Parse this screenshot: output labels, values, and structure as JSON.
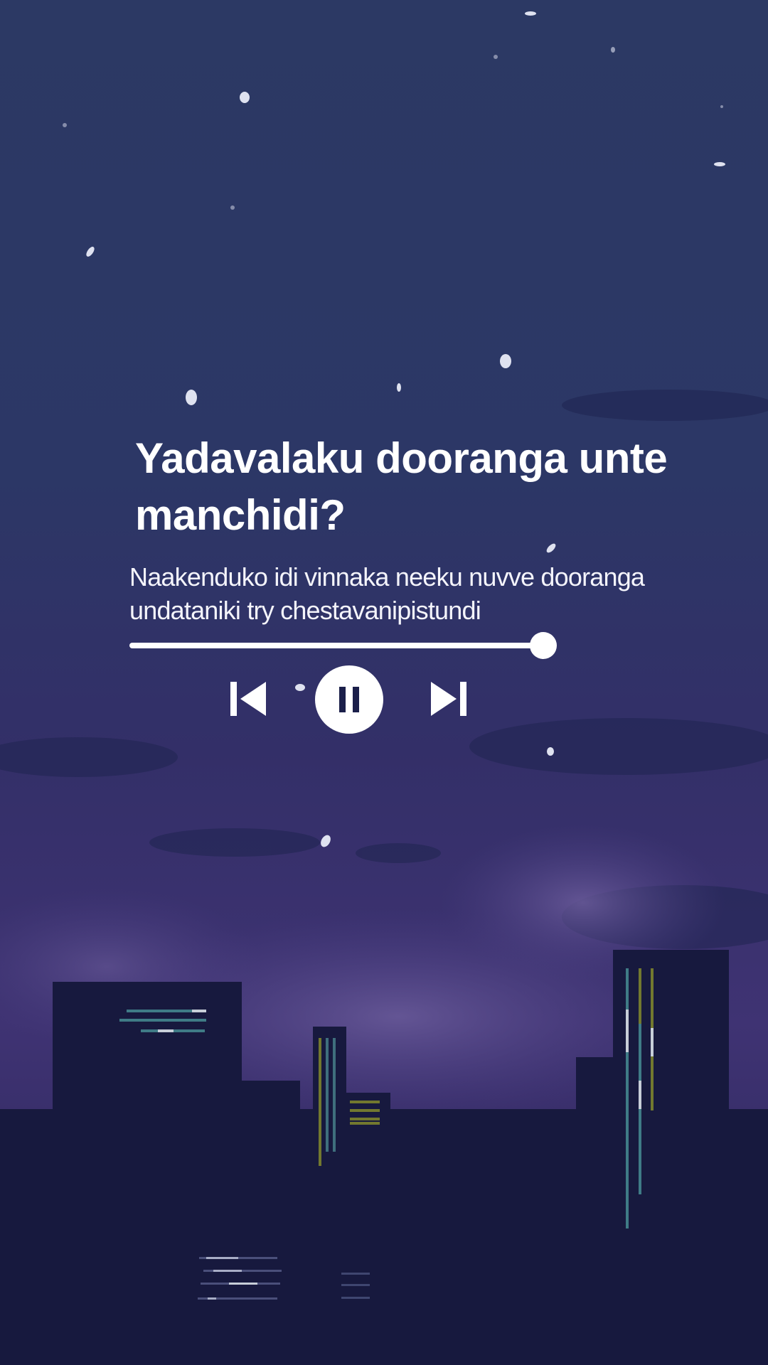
{
  "song": {
    "title": "Yadavalaku dooranga unte manchidi?",
    "lyric": "Naakenduko idi vinnaka neeku nuvve dooranga undataniki try chestavanipistundi"
  },
  "playback": {
    "progress": 0.97,
    "state": "playing"
  },
  "controls": {
    "previous_icon": "skip-previous-icon",
    "pause_icon": "pause-icon",
    "next_icon": "skip-next-icon"
  },
  "colors": {
    "sky_top": "#2b3863",
    "sky_bottom": "#3b2f6b",
    "buildings": "#17193d",
    "foreground": "#ffffff"
  }
}
